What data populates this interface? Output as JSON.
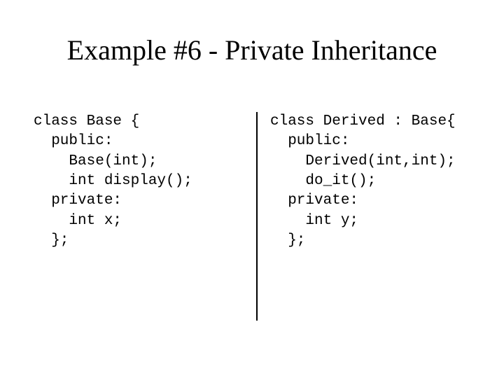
{
  "slide": {
    "title": "Example #6 - Private Inheritance",
    "left_code": "class Base {\n  public:\n    Base(int);\n    int display();\n  private:\n    int x;\n  };",
    "right_code": "class Derived : Base{\n  public:\n    Derived(int,int);\n    do_it();\n  private:\n    int y;\n  };"
  }
}
